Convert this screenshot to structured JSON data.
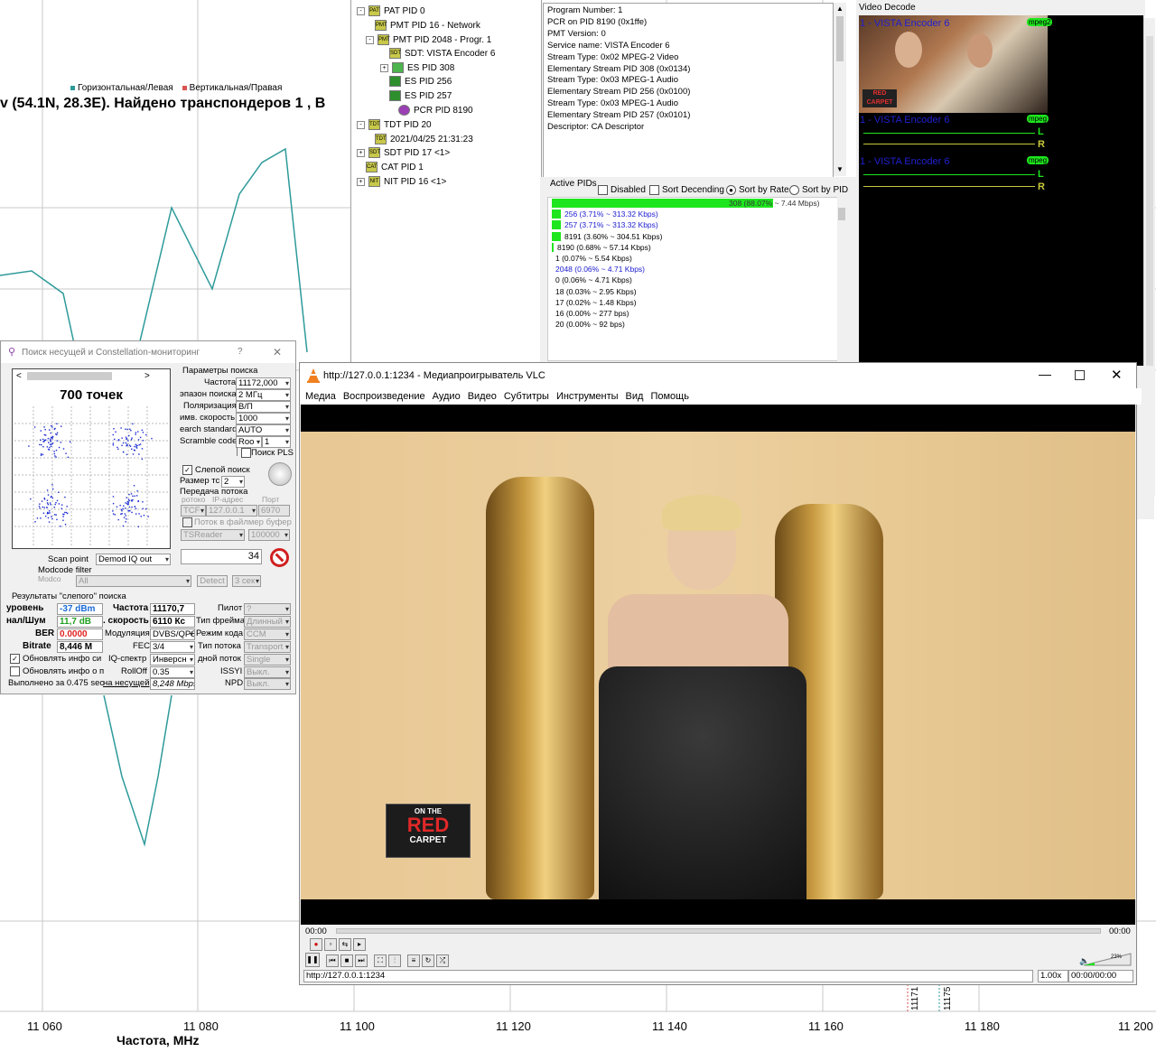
{
  "spectrum": {
    "legend": [
      {
        "label": "Горизонтальная/Левая",
        "color": "#2e9a9a"
      },
      {
        "label": "Вертикальная/Правая",
        "color": "#d9534f"
      }
    ],
    "title": "v (54.1N, 28.3E). Найдено транспондеров 1 , В",
    "x_ticks": [
      "11 060",
      "11 080",
      "11 100",
      "11 120",
      "11 140",
      "11 160",
      "11 180",
      "11 200"
    ],
    "x_label": "Частота, MHz",
    "markers": [
      "11171",
      "11175"
    ]
  },
  "tree": {
    "items": [
      {
        "label": "PAT PID 0",
        "exp": "-"
      },
      {
        "label": "PMT PID 16 - Network"
      },
      {
        "label": "PMT PID 2048 - Progr. 1",
        "exp": "-"
      },
      {
        "label": "SDT: VISTA Encoder 6"
      },
      {
        "label": "ES PID 308",
        "exp": "+"
      },
      {
        "label": "ES PID 256"
      },
      {
        "label": "ES PID 257"
      },
      {
        "label": "PCR PID 8190"
      },
      {
        "label": "TDT PID 20",
        "exp": "-"
      },
      {
        "label": "2021/04/25 21:31:23"
      },
      {
        "label": "SDT PID 17 <1>",
        "exp": "+"
      },
      {
        "label": "CAT PID 1"
      },
      {
        "label": "NIT PID 16 <1>",
        "exp": "+"
      }
    ]
  },
  "info": {
    "lines": [
      "Program Number: 1",
      "PCR on PID 8190 (0x1ffe)",
      "PMT Version: 0",
      "Service name: VISTA Encoder 6",
      "",
      "Stream Type: 0x02 MPEG-2 Video",
      " Elementary Stream PID 308 (0x0134)",
      "",
      "Stream Type: 0x03 MPEG-1 Audio",
      " Elementary Stream PID 256 (0x0100)",
      "",
      "Stream Type: 0x03 MPEG-1 Audio",
      " Elementary Stream PID 257 (0x0101)",
      "",
      "Descriptor: CA Descriptor"
    ]
  },
  "active_pids": {
    "title": "Active PIDs",
    "options": {
      "disabled": "Disabled",
      "sort_desc": "Sort Decending",
      "sort_rate": "Sort by Rate",
      "sort_pid": "Sort by PID"
    },
    "rows": [
      {
        "text": "308 (88.07% ~ 7.44 Mbps)",
        "pct": 88.07,
        "color": "#333"
      },
      {
        "text": "256 (3.71% ~ 313.32 Kbps)",
        "pct": 3.71,
        "color": "#2020d0"
      },
      {
        "text": "257 (3.71% ~ 313.32 Kbps)",
        "pct": 3.71,
        "color": "#2020d0"
      },
      {
        "text": "8191 (3.60% ~ 304.51 Kbps)",
        "pct": 3.6,
        "color": "#000"
      },
      {
        "text": "8190 (0.68% ~ 57.14 Kbps)",
        "pct": 0.68,
        "color": "#000"
      },
      {
        "text": "1 (0.07% ~ 5.54 Kbps)",
        "pct": 0.07,
        "color": "#000"
      },
      {
        "text": "2048 (0.06% ~ 4.71 Kbps)",
        "pct": 0.06,
        "color": "#2020d0"
      },
      {
        "text": "0 (0.06% ~ 4.71 Kbps)",
        "pct": 0.06,
        "color": "#000"
      },
      {
        "text": "18 (0.03% ~ 2.95 Kbps)",
        "pct": 0.03,
        "color": "#000"
      },
      {
        "text": "17 (0.02% ~ 1.48 Kbps)",
        "pct": 0.02,
        "color": "#000"
      },
      {
        "text": "16 (0.00% ~ 277 bps)",
        "pct": 0,
        "color": "#000"
      },
      {
        "text": "20 (0.00% ~ 92 bps)",
        "pct": 0,
        "color": "#000"
      }
    ]
  },
  "video_decode": {
    "title": "Video Decode",
    "stream1": "1 - VISTA Encoder 6",
    "badge1": "mpeg2",
    "stream2": "1 - VISTA Encoder 6",
    "badge2": "mpeg",
    "stream3": "1 - VISTA Encoder 6",
    "badge3": "mpeg",
    "L": "L",
    "R": "R",
    "thumb_logo": "RED CARPET"
  },
  "vlc": {
    "title": "http://127.0.0.1:1234 - Медиапроигрыватель VLC",
    "menu": [
      "Медиа",
      "Воспроизведение",
      "Аудио",
      "Видео",
      "Субтитры",
      "Инструменты",
      "Вид",
      "Помощь"
    ],
    "time_left": "00:00",
    "time_right": "00:00",
    "url": "http://127.0.0.1:1234",
    "speed": "1.00x",
    "time_field": "00:00/00:00",
    "volume": "23%",
    "logo_top": "ON THE",
    "logo_main": "RED",
    "logo_bottom": "CARPET"
  },
  "dialog": {
    "title": "Поиск несущей и Constellation-мониторинг",
    "help": "?",
    "close": "✕",
    "points": "700 точек",
    "search_params": "Параметры поиска",
    "freq_lbl": "Частота",
    "freq_val": "11172,000",
    "range_lbl": "эпазон поиска",
    "range_val": "2 МГц",
    "pol_lbl": "Поляризация",
    "pol_val": "В/П",
    "sr_lbl": "имв. скорость",
    "sr_val": "1000",
    "std_lbl": "earch standard",
    "std_val": "AUTO",
    "scr_lbl": "Scramble code",
    "scr_val1": "Roo",
    "scr_val2": "1",
    "pls_lbl": "Поиск PLS",
    "blind_lbl": "Слепой поиск",
    "size_lbl": "Размер тс",
    "size_val": "2",
    "stream_lbl": "Передача потока",
    "proto_lbl": "ротоко",
    "ip_lbl": "IP-адрес",
    "port_lbl": "Порт",
    "proto_val": "TCF",
    "ip_val": "127.0.0.1",
    "port_val": "6970",
    "file_lbl": "Поток в файлмер буфер",
    "reader_val": "TSReader",
    "buf_val": "100000",
    "scan_lbl": "Scan point",
    "scan_val": "Demod IQ out",
    "counter": "34",
    "modcode_lbl": "Modcode filter",
    "modco_lbl": "Modco",
    "all_val": "All",
    "detect": "Detect",
    "sec_val": "3 сек",
    "results_lbl": "Результаты \"слепого\" поиска",
    "lvl_lbl": "уровень",
    "lvl_val": "-37 dBm",
    "snr_lbl": "нал/Шум",
    "snr_val": "11,7 dB",
    "ber_lbl": "BER",
    "ber_val": "0.0000",
    "bitrate_lbl": "Bitrate",
    "bitrate_val": "8,446 M",
    "rfreq_lbl": "Частота",
    "rfreq_val": "11170,7",
    "rsr_lbl": ". скорость",
    "rsr_val": "6110 Кс",
    "mod_lbl": "Модуляция",
    "mod_val": "DVBS/QPSK",
    "fec_lbl": "FEC",
    "fec_val": "3/4",
    "iq_lbl": "IQ-спектр",
    "iq_val": "Инверсн",
    "roll_lbl": "RollOff",
    "roll_val": "0.35",
    "carrier_lbl": "на несущей",
    "carrier_val": "8,248 Mbps",
    "pilot_lbl": "Пилот",
    "pilot_val": "?",
    "frame_lbl": "Тип фрейма",
    "frame_val": "Длинный",
    "code_lbl": "Режим кода",
    "code_val": "CCM",
    "stype_lbl": "Тип потока",
    "stype_val": "Transport",
    "inp_lbl": "дной поток",
    "inp_val": "Single",
    "issyi_lbl": "ISSYI",
    "issyi_val": "Выкл.",
    "npd_lbl": "NPD",
    "npd_val": "Выкл.",
    "upd1_lbl": "Обновлять инфо си",
    "upd2_lbl": "Обновлять инфо о п",
    "done_lbl": "Выполнено за 0.475 sec"
  }
}
